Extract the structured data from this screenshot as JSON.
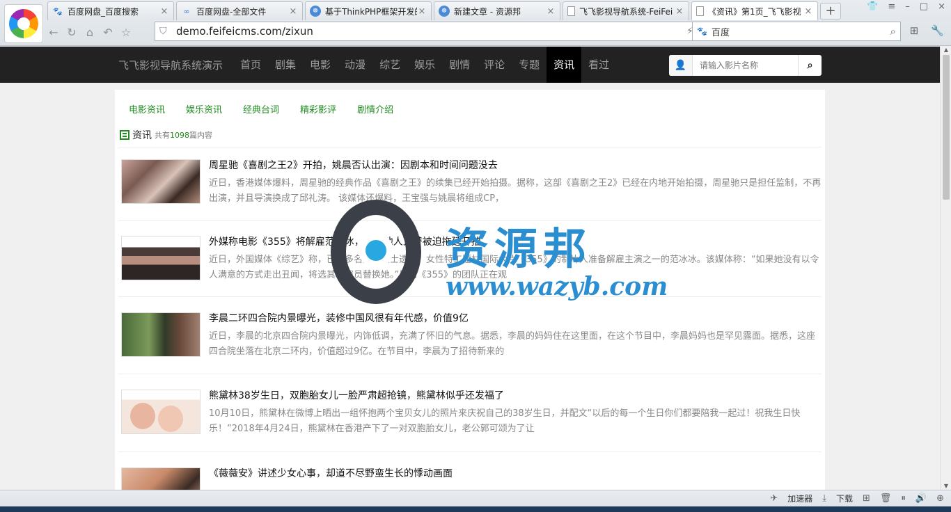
{
  "browser": {
    "tabs": [
      {
        "icon": "baidu-paw-icon",
        "label": "百度网盘_百度搜索",
        "active": false
      },
      {
        "icon": "baidu-pan-icon",
        "label": "百度网盘-全部文件",
        "active": false
      },
      {
        "icon": "ziyuanbang-icon",
        "label": "基于ThinkPHP框架开发的",
        "active": false
      },
      {
        "icon": "ziyuanbang-icon",
        "label": "新建文章 - 资源邦",
        "active": false
      },
      {
        "icon": "page-icon",
        "label": "飞飞影视导航系统-FeiFei",
        "active": false
      },
      {
        "icon": "page-icon",
        "label": "《资讯》第1页_飞飞影视",
        "active": true
      }
    ],
    "url": "demo.feifeicms.com/zixun",
    "search_engine": "百度"
  },
  "site": {
    "brand": "飞飞影视导航系统演示",
    "menu": [
      {
        "label": "首页",
        "active": false
      },
      {
        "label": "剧集",
        "active": false
      },
      {
        "label": "电影",
        "active": false
      },
      {
        "label": "动漫",
        "active": false
      },
      {
        "label": "综艺",
        "active": false
      },
      {
        "label": "娱乐",
        "active": false
      },
      {
        "label": "剧情",
        "active": false
      },
      {
        "label": "评论",
        "active": false
      },
      {
        "label": "专题",
        "active": false
      },
      {
        "label": "资讯",
        "active": true
      },
      {
        "label": "看过",
        "active": false
      }
    ],
    "search_placeholder": "请输入影片名称",
    "accent_color": "#1f8a1f"
  },
  "subnav": [
    "电影资讯",
    "娱乐资讯",
    "经典台词",
    "精彩影评",
    "剧情介绍"
  ],
  "section": {
    "title": "资讯",
    "count_prefix": "共有",
    "count": "1098",
    "count_suffix": "篇内容"
  },
  "articles": [
    {
      "title": "周星驰《喜剧之王2》开拍，姚晨否认出演：因剧本和时间问题没去",
      "desc": "近日，香港媒体爆料，周星驰的经典作品《喜剧之王》的续集已经开始拍摄。据称，这部《喜剧之王2》已经在内地开始拍摄，周星驰只是担任监制，不再出演，并且导演换成了邱礼涛。 该媒体还爆料，王宝强与姚晨将组成CP，"
    },
    {
      "title": "外媒称电影《355》将解雇范冰冰，寻找他人顶替被迫拖延开拍",
      "desc": "近日，外国媒体《综艺》称，已有多名知情人士透露：女性特工题材国际大片《355》的制片人准备解雇主演之一的范冰冰。该媒体称：“如果她没有以令人满意的方式走出丑闻，将选其他演员替换她。”目前《355》的团队正在观"
    },
    {
      "title": "李晨二环四合院内景曝光，装修中国风很有年代感，价值9亿",
      "desc": "近日，李晨的北京四合院内景曝光，内饰低调，充满了怀旧的气息。据悉，李晨的妈妈住在这里面，在这个节目中，李晨妈妈也是罕见露面。据悉，这座四合院坐落在北京二环内，价值超过9亿。在节目中，李晨为了招待新来的"
    },
    {
      "title": "熊黛林38岁生日，双胞胎女儿一脸严肃超抢镜，熊黛林似乎还发福了",
      "desc": "10月10日，熊黛林在微博上晒出一组怀抱两个宝贝女儿的照片来庆祝自己的38岁生日，并配文“以后的每一个生日你们都要陪我一起过！祝我生日快乐！”2018年4月24日，熊黛林在香港产下了一对双胞胎女儿，老公郭可颂为了让"
    },
    {
      "title": "《薇薇安》讲述少女心事，却道不尽野蛮生长的悸动画面",
      "desc": ""
    }
  ],
  "watermark": {
    "cn": "资源邦",
    "en": "www.wazyb.com"
  },
  "statusbar": {
    "accelerator": "加速器",
    "download": "下载"
  }
}
